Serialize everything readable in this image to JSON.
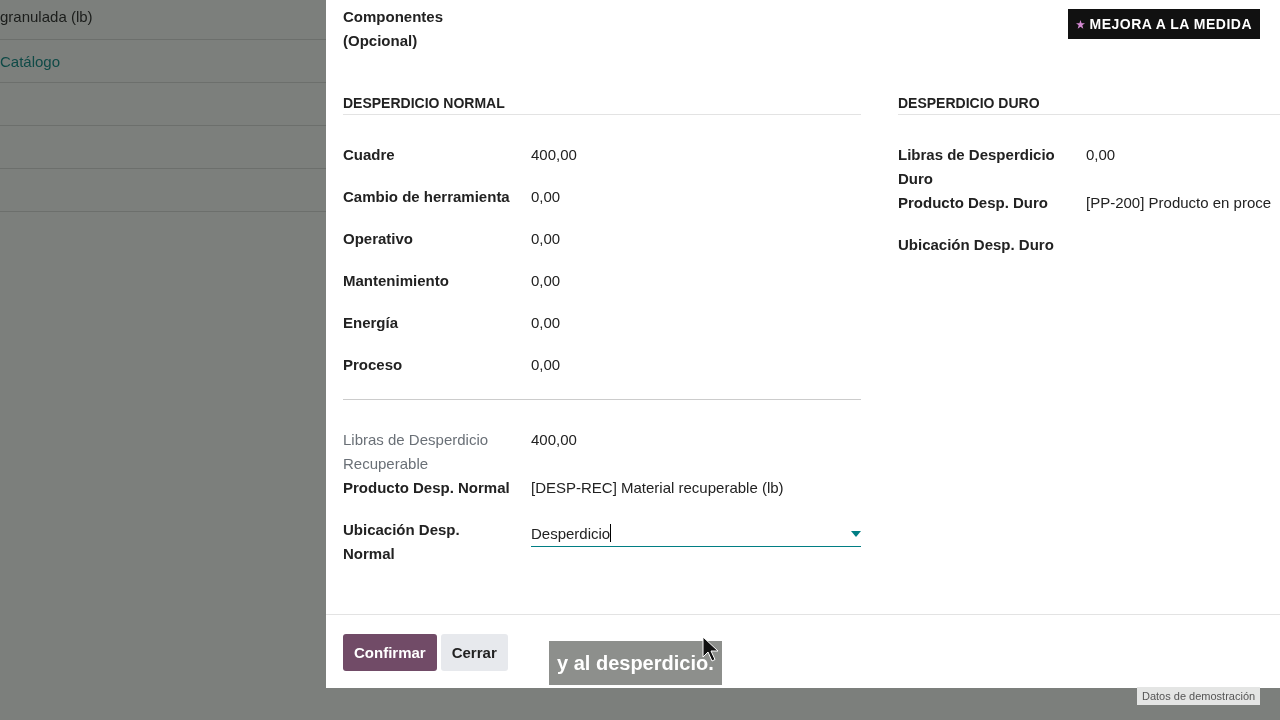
{
  "background": {
    "rows": [
      {
        "text": "granulada (lb)",
        "kind": "text"
      },
      {
        "text": "Catálogo",
        "kind": "link"
      }
    ]
  },
  "dialog": {
    "top_label": "Componentes (Opcional)",
    "badge": "MEJORA A LA MEDIDA",
    "sections": [
      {
        "title": "DESPERDICIO NORMAL",
        "groups": [
          [
            {
              "label": "Cuadre",
              "value": "400,00",
              "kind": "readonly"
            },
            {
              "label": "Cambio de herramienta",
              "value": "0,00",
              "kind": "readonly"
            },
            {
              "label": "Operativo",
              "value": "0,00",
              "kind": "readonly"
            },
            {
              "label": "Mantenimiento",
              "value": "0,00",
              "kind": "readonly"
            },
            {
              "label": "Energía",
              "value": "0,00",
              "kind": "readonly"
            },
            {
              "label": "Proceso",
              "value": "0,00",
              "kind": "readonly"
            }
          ],
          [
            {
              "label": "Libras de Desperdicio Recuperable",
              "value": "400,00",
              "kind": "muted"
            },
            {
              "label": "Producto Desp. Normal",
              "value": "[DESP-REC] Material recuperable (lb)",
              "kind": "readonly"
            },
            {
              "label": "Ubicación Desp. Normal",
              "value": "Desperdicio",
              "kind": "select"
            }
          ]
        ]
      },
      {
        "title": "DESPERDICIO DURO",
        "groups": [
          [
            {
              "label": "Libras de Desperdicio Duro",
              "value": "0,00",
              "kind": "readonly"
            },
            {
              "label": "Producto Desp. Duro",
              "value": "[PP-200] Producto en proce",
              "kind": "readonly"
            },
            {
              "label": "Ubicación Desp. Duro",
              "kind": "readonly"
            }
          ]
        ]
      }
    ],
    "buttons": [
      {
        "label": "Confirmar",
        "primary": true
      },
      {
        "label": "Cerrar",
        "primary": false
      }
    ]
  },
  "caption": "y al desperdicio.",
  "demo_label": "Datos de demostración"
}
